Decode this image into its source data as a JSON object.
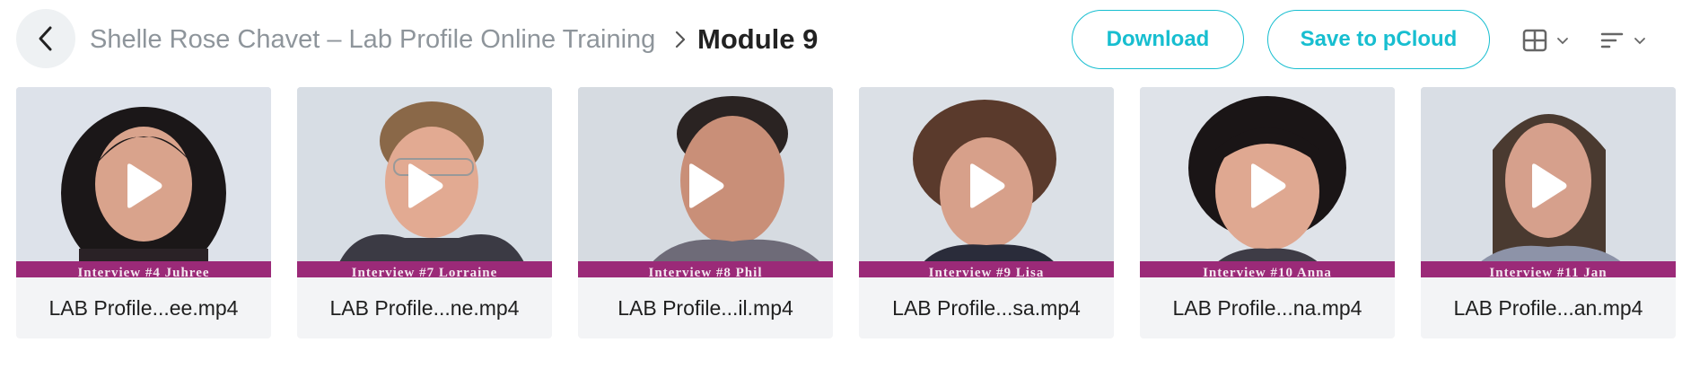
{
  "header": {
    "back_icon": "chevron-left-icon",
    "parent_folder": "Shelle Rose Chavet – Lab Profile Online Training",
    "separator_icon": "chevron-right-icon",
    "current_folder": "Module 9",
    "download_label": "Download",
    "save_label": "Save to pCloud",
    "view_icon": "grid-view-icon",
    "sort_icon": "sort-lines-icon"
  },
  "colors": {
    "accent": "#17bed0",
    "caption_band": "#9b2a78",
    "card_bg": "#f3f4f6",
    "muted_text": "#8e959b"
  },
  "files": [
    {
      "name": "LAB Profile...ee.mp4",
      "thumb_caption": "Interview #4 Juhree"
    },
    {
      "name": "LAB Profile...ne.mp4",
      "thumb_caption": "Interview #7 Lorraine"
    },
    {
      "name": "LAB Profile...il.mp4",
      "thumb_caption": "Interview #8 Phil"
    },
    {
      "name": "LAB Profile...sa.mp4",
      "thumb_caption": "Interview #9 Lisa"
    },
    {
      "name": "LAB Profile...na.mp4",
      "thumb_caption": "Interview #10 Anna"
    },
    {
      "name": "LAB Profile...an.mp4",
      "thumb_caption": "Interview #11 Jan"
    }
  ]
}
